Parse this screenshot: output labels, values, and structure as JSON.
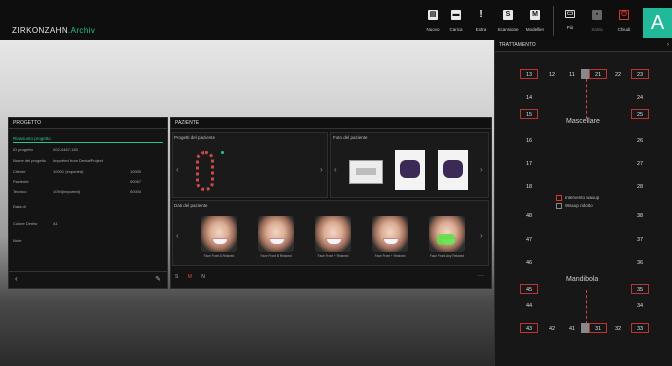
{
  "brand": {
    "name": "ZIRKONZAHN",
    "sub": ".Archiv"
  },
  "toolbar": [
    {
      "label": "Nuovo",
      "glyph": "▤"
    },
    {
      "label": "Carica",
      "glyph": "▬"
    },
    {
      "label": "Extra",
      "glyph": "!"
    },
    {
      "label": "Scansione",
      "glyph": "S"
    },
    {
      "label": "Modellier",
      "glyph": "M"
    },
    {
      "label": "Più",
      "glyph": "▭"
    },
    {
      "label": "Salva",
      "glyph": "▪"
    },
    {
      "label": "Chiudi",
      "glyph": "⏻"
    }
  ],
  "user": {
    "initial": "A"
  },
  "progetto": {
    "title": "PROGETTO",
    "selected": "Riassunto progetto",
    "rows": [
      {
        "k": "ID progetto",
        "v1": "002-0467-183",
        "v2": ""
      },
      {
        "k": "Nome del progetto",
        "v1": "Imported from DentalProject",
        "v2": ""
      },
      {
        "k": "Cliente",
        "v1": "10001 (imported)",
        "v2": "10000"
      },
      {
        "k": "Paziente",
        "v1": "",
        "v2": "00067"
      },
      {
        "k": "Tecnico",
        "v1": "1094(imported)",
        "v2": "00004"
      },
      {
        "k": "Data di",
        "v1": "",
        "v2": ""
      },
      {
        "k": "Colore Dentw",
        "v1": "A1",
        "v2": ""
      },
      {
        "k": "Note",
        "v1": "",
        "v2": ""
      }
    ]
  },
  "paziente": {
    "title": "PAZIENTE",
    "progetti_label": "Progetti del paziente",
    "foto_label": "Foto del paziente",
    "dati_label": "Dati del paziente",
    "faces": [
      "Face Front A Relaxed",
      "Face Front B Relaxed",
      "Face Front + Relaxed",
      "Face Front + Relaxed",
      "Face Front Any Relaxed"
    ],
    "tabs": [
      "S",
      "M",
      "N"
    ]
  },
  "trattamento": {
    "title": "TRATTAMENTO",
    "upper_label": "Mascellare",
    "lower_label": "Mandibola",
    "legend": [
      "Intervento waxup",
      "Waxup ridotto"
    ],
    "top_row": [
      "13",
      "12",
      "11",
      "21",
      "22",
      "23"
    ],
    "bottom_row": [
      "43",
      "42",
      "41",
      "31",
      "32",
      "33"
    ],
    "left_col": [
      "14",
      "15",
      "16",
      "17",
      "18",
      "48",
      "47",
      "46",
      "45",
      "44"
    ],
    "right_col": [
      "24",
      "25",
      "26",
      "27",
      "28",
      "38",
      "37",
      "36",
      "35",
      "34"
    ]
  }
}
